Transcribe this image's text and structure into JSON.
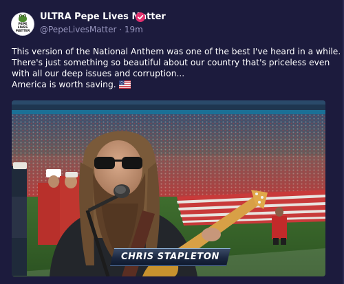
{
  "post": {
    "display_name": "ULTRA Pepe Lives Matter",
    "handle": "@PepeLivesMatter",
    "separator": "·",
    "time_ago": "19m",
    "lines": [
      "This version of the National Anthem was one of the best I've heard in a while.",
      "There's just something so beautiful about our country that's priceless even",
      "with all our deep issues and corruption...",
      "America is worth saving."
    ]
  },
  "avatar": {
    "line1": "PEPE",
    "line2": "LIVES",
    "line3": "MATTER"
  },
  "media": {
    "chyron_text": "CHRIS STAPLETON"
  },
  "icons": {
    "verified": "verified-badge-icon",
    "flag": "us-flag-emoji-icon"
  },
  "colors": {
    "background": "#1c1b3d",
    "handle_text": "#9a98c0",
    "verified_badge": "#e0306e"
  }
}
